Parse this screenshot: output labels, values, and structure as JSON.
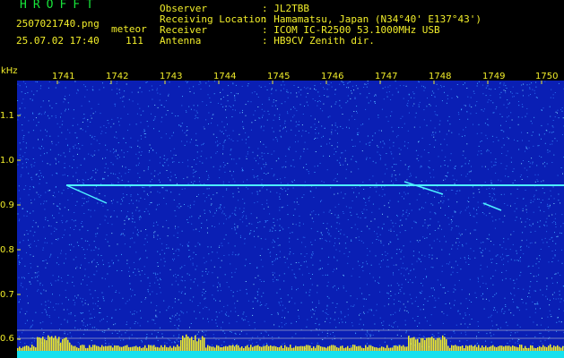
{
  "header": {
    "logo": "HROFFT",
    "filename": "2507021740.png",
    "datetime": "25.07.02 17:40",
    "meteor_label": "meteor",
    "meteor_count": "111",
    "fields": [
      {
        "label": "Observer",
        "value": ": JL2TBB"
      },
      {
        "label": "Receiving Location",
        "value": ": Hamamatsu, Japan (N34°40' E137°43')"
      },
      {
        "label": "Receiver",
        "value": ": ICOM IC-R2500 53.1000MHz USB"
      },
      {
        "label": "Antenna",
        "value": ": HB9CV Zenith dir."
      }
    ]
  },
  "spectrogram": {
    "y_unit": "kHz",
    "y_ticks": [
      "1.1",
      "1.0",
      "0.9",
      "0.8",
      "0.7",
      "0.6"
    ],
    "x_ticks": [
      "1741",
      "1742",
      "1743",
      "1744",
      "1745",
      "1746",
      "1747",
      "1748",
      "1749",
      "1750"
    ],
    "colors": {
      "background": "#0a1fb4",
      "noise": "#3fa0ff",
      "trace": "#4df0ff",
      "labels": "#f2ee2a",
      "logo": "#17e53a",
      "signal_bar": "#f2ee2a",
      "bottom_band": "#16e0ee"
    }
  }
}
